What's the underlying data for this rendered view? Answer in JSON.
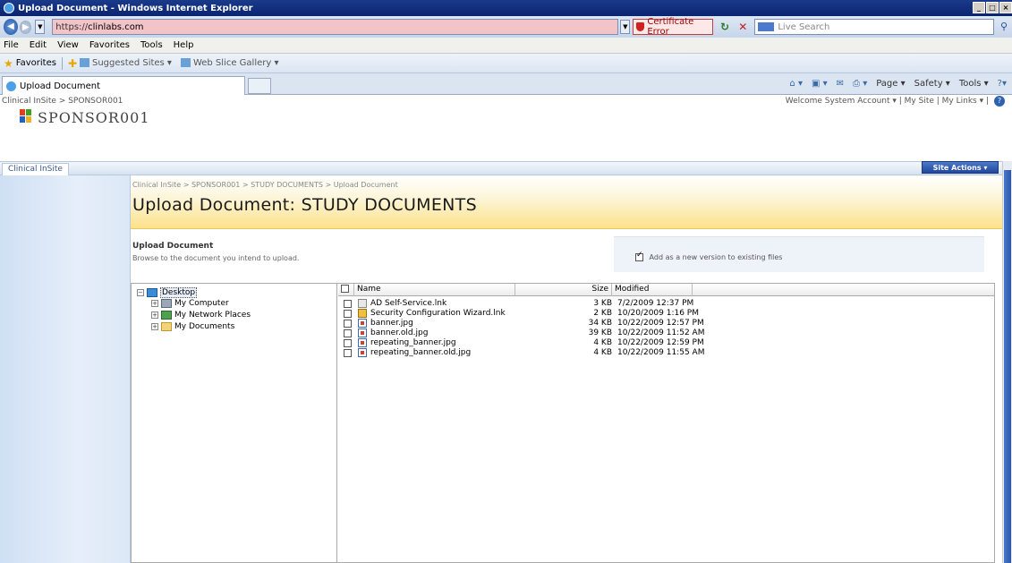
{
  "window": {
    "title": "Upload Document - Windows Internet Explorer"
  },
  "address_bar": {
    "url_prefix": "https://",
    "url_host": "clinlabs.com",
    "cert_error": "Certificate Error",
    "search_placeholder": "Live Search"
  },
  "menu": [
    "File",
    "Edit",
    "View",
    "Favorites",
    "Tools",
    "Help"
  ],
  "favorites_bar": {
    "label": "Favorites",
    "items": [
      "Suggested Sites ▾",
      "Web Slice Gallery ▾"
    ]
  },
  "tab": {
    "label": "Upload Document"
  },
  "command_bar": {
    "items": [
      "Page ▾",
      "Safety ▾",
      "Tools ▾"
    ]
  },
  "sharepoint": {
    "global_breadcrumb": "Clinical InSite > SPONSOR001",
    "welcome": "Welcome System Account ▾  |  My Site  |  My Links ▾  |",
    "site_name": "SPONSOR001",
    "home_tab": "Clinical InSite",
    "site_actions": "Site Actions ▾",
    "page_breadcrumb": "Clinical InSite > SPONSOR001 > STUDY DOCUMENTS > Upload Document",
    "page_title": "Upload Document: STUDY DOCUMENTS",
    "upload_label": "Upload Document",
    "upload_desc": "Browse to the document you intend to upload.",
    "version_label": "Add as a new version to existing files",
    "version_checked": true
  },
  "tree": [
    {
      "label": "Desktop",
      "expander": "−",
      "icon": "desktop-icon"
    },
    {
      "label": "My Computer",
      "expander": "+",
      "icon": "computer-icon"
    },
    {
      "label": "My Network Places",
      "expander": "+",
      "icon": "network-icon"
    },
    {
      "label": "My Documents",
      "expander": "+",
      "icon": "documents-folder-icon"
    }
  ],
  "file_list": {
    "columns": {
      "name": "Name",
      "size": "Size",
      "modified": "Modified"
    },
    "rows": [
      {
        "name": "AD Self-Service.lnk",
        "size": "3 KB",
        "modified": "7/2/2009 12:37 PM",
        "icon": "shortcut-icon"
      },
      {
        "name": "Security Configuration Wizard.lnk",
        "size": "2 KB",
        "modified": "10/20/2009 1:16 PM",
        "icon": "wizard-shortcut-icon"
      },
      {
        "name": "banner.jpg",
        "size": "34 KB",
        "modified": "10/22/2009 12:57 PM",
        "icon": "image-file-icon"
      },
      {
        "name": "banner.old.jpg",
        "size": "39 KB",
        "modified": "10/22/2009 11:52 AM",
        "icon": "image-file-icon"
      },
      {
        "name": "repeating_banner.jpg",
        "size": "4 KB",
        "modified": "10/22/2009 12:59 PM",
        "icon": "image-file-icon"
      },
      {
        "name": "repeating_banner.old.jpg",
        "size": "4 KB",
        "modified": "10/22/2009 11:55 AM",
        "icon": "image-file-icon"
      }
    ]
  }
}
